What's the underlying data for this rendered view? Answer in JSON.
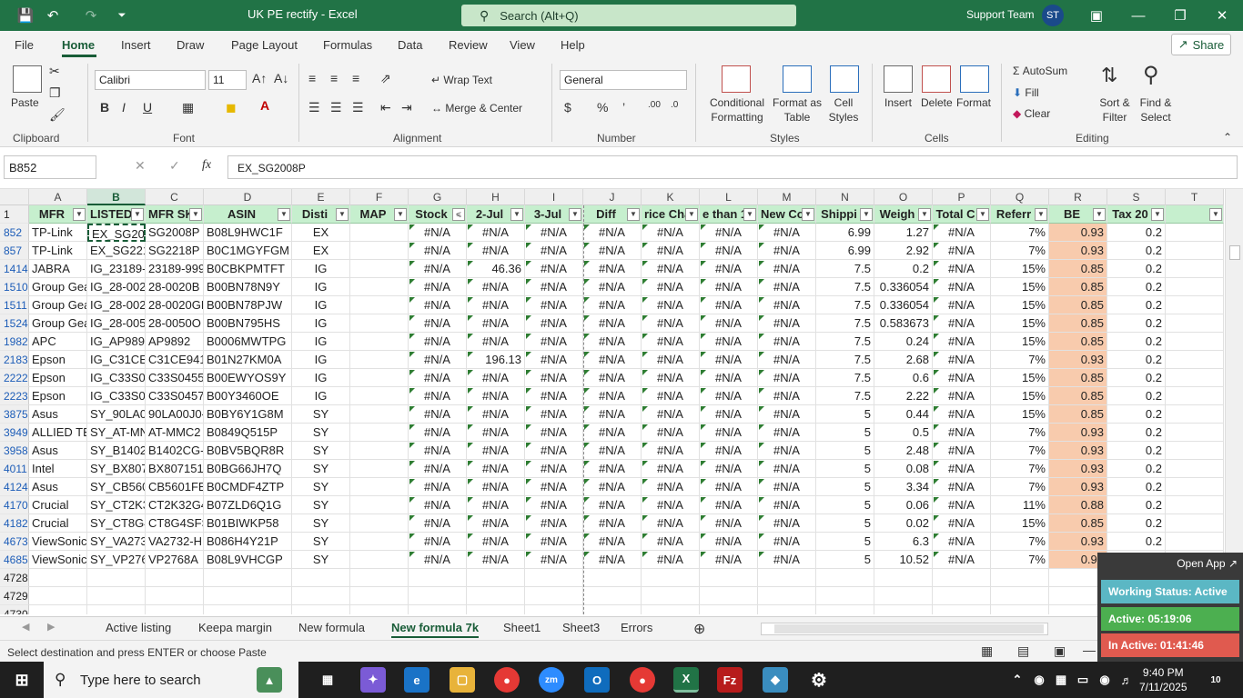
{
  "window": {
    "title": "UK PE rectify  -  Excel",
    "search_placeholder": "Search (Alt+Q)",
    "user_name": "Support Team",
    "user_initials": "ST"
  },
  "menu": [
    "File",
    "Home",
    "Insert",
    "Draw",
    "Page Layout",
    "Formulas",
    "Data",
    "Review",
    "View",
    "Help"
  ],
  "share_label": "Share",
  "ribbon": {
    "paste": "Paste",
    "font_name": "Calibri",
    "font_size": "11",
    "wrap_text": "Wrap Text",
    "merge_center": "Merge & Center",
    "number_format": "General",
    "conditional_formatting": [
      "Conditional",
      "Formatting"
    ],
    "format_as_table": [
      "Format as",
      "Table"
    ],
    "cell_styles": [
      "Cell",
      "Styles"
    ],
    "insert": "Insert",
    "delete": "Delete",
    "format": "Format",
    "autosum": "AutoSum",
    "fill": "Fill",
    "clear": "Clear",
    "sort_filter": [
      "Sort &",
      "Filter"
    ],
    "find_select": [
      "Find &",
      "Select"
    ],
    "groups": [
      "Clipboard",
      "Font",
      "Alignment",
      "Number",
      "Styles",
      "Cells",
      "Editing"
    ]
  },
  "formula_bar": {
    "name_box": "B852",
    "formula": "EX_SG2008P"
  },
  "grid": {
    "columns": [
      "A",
      "B",
      "C",
      "D",
      "E",
      "F",
      "G",
      "H",
      "I",
      "J",
      "K",
      "L",
      "M",
      "N",
      "O",
      "P",
      "Q",
      "R",
      "S",
      "T"
    ],
    "selected_column": "B",
    "header_row_num": "1",
    "headers": [
      "MFR",
      "LISTED S",
      "MFR SK",
      "ASIN",
      "Disti",
      "MAP",
      "Stock",
      "2-Jul",
      "3-Jul",
      "Diff",
      "rice Cha",
      "e than 1",
      "New Co",
      "Shippi",
      "Weigh",
      "Total C",
      "Referr",
      "BE",
      "Tax 20",
      ""
    ],
    "rows": [
      {
        "num": "852",
        "cells": [
          "TP-Link",
          "EX_SG200",
          "SG2008P",
          "B08L9HWC1F",
          "EX",
          "",
          "#N/A",
          "#N/A",
          "#N/A",
          "#N/A",
          "#N/A",
          "#N/A",
          "#N/A",
          "6.99",
          "1.27",
          "#N/A",
          "7%",
          "0.93",
          "0.2"
        ]
      },
      {
        "num": "857",
        "cells": [
          "TP-Link",
          "EX_SG221",
          "SG2218P",
          "B0C1MGYFGM",
          "EX",
          "",
          "#N/A",
          "#N/A",
          "#N/A",
          "#N/A",
          "#N/A",
          "#N/A",
          "#N/A",
          "6.99",
          "2.92",
          "#N/A",
          "7%",
          "0.93",
          "0.2"
        ]
      },
      {
        "num": "1414",
        "cells": [
          "JABRA",
          "IG_23189-",
          "23189-999",
          "B0CBKPMTFT",
          "IG",
          "",
          "#N/A",
          "46.36",
          "#N/A",
          "#N/A",
          "#N/A",
          "#N/A",
          "#N/A",
          "7.5",
          "0.2",
          "#N/A",
          "15%",
          "0.85",
          "0.2"
        ]
      },
      {
        "num": "1510",
        "cells": [
          "Group Gea",
          "IG_28-002",
          "28-0020B",
          "B00BN78N9Y",
          "IG",
          "",
          "#N/A",
          "#N/A",
          "#N/A",
          "#N/A",
          "#N/A",
          "#N/A",
          "#N/A",
          "7.5",
          "0.336054",
          "#N/A",
          "15%",
          "0.85",
          "0.2"
        ]
      },
      {
        "num": "1511",
        "cells": [
          "Group Gea",
          "IG_28-002",
          "28-0020GN",
          "B00BN78PJW",
          "IG",
          "",
          "#N/A",
          "#N/A",
          "#N/A",
          "#N/A",
          "#N/A",
          "#N/A",
          "#N/A",
          "7.5",
          "0.336054",
          "#N/A",
          "15%",
          "0.85",
          "0.2"
        ]
      },
      {
        "num": "1524",
        "cells": [
          "Group Gea",
          "IG_28-005",
          "28-0050O",
          "B00BN795HS",
          "IG",
          "",
          "#N/A",
          "#N/A",
          "#N/A",
          "#N/A",
          "#N/A",
          "#N/A",
          "#N/A",
          "7.5",
          "0.583673",
          "#N/A",
          "15%",
          "0.85",
          "0.2"
        ]
      },
      {
        "num": "1982",
        "cells": [
          "APC",
          "IG_AP989",
          "AP9892",
          "B0006MWTPG",
          "IG",
          "",
          "#N/A",
          "#N/A",
          "#N/A",
          "#N/A",
          "#N/A",
          "#N/A",
          "#N/A",
          "7.5",
          "0.24",
          "#N/A",
          "15%",
          "0.85",
          "0.2"
        ]
      },
      {
        "num": "2183",
        "cells": [
          "Epson",
          "IG_C31CE5",
          "C31CE941",
          "B01N27KM0A",
          "IG",
          "",
          "#N/A",
          "196.13",
          "#N/A",
          "#N/A",
          "#N/A",
          "#N/A",
          "#N/A",
          "7.5",
          "2.68",
          "#N/A",
          "7%",
          "0.93",
          "0.2"
        ]
      },
      {
        "num": "2222",
        "cells": [
          "Epson",
          "IG_C33S04",
          "C33S04554",
          "B00EWYOS9Y",
          "IG",
          "",
          "#N/A",
          "#N/A",
          "#N/A",
          "#N/A",
          "#N/A",
          "#N/A",
          "#N/A",
          "7.5",
          "0.6",
          "#N/A",
          "15%",
          "0.85",
          "0.2"
        ]
      },
      {
        "num": "2223",
        "cells": [
          "Epson",
          "IG_C33S04",
          "C33S04571",
          "B00Y3460OE",
          "IG",
          "",
          "#N/A",
          "#N/A",
          "#N/A",
          "#N/A",
          "#N/A",
          "#N/A",
          "#N/A",
          "7.5",
          "2.22",
          "#N/A",
          "15%",
          "0.85",
          "0.2"
        ]
      },
      {
        "num": "3875",
        "cells": [
          "Asus",
          "SY_90LA00",
          "90LA00J0-",
          "B0BY6Y1G8M",
          "SY",
          "",
          "#N/A",
          "#N/A",
          "#N/A",
          "#N/A",
          "#N/A",
          "#N/A",
          "#N/A",
          "5",
          "0.44",
          "#N/A",
          "15%",
          "0.85",
          "0.2"
        ]
      },
      {
        "num": "3949",
        "cells": [
          "ALLIED TEL",
          "SY_AT-MN",
          "AT-MMC2",
          "B0849Q515P",
          "SY",
          "",
          "#N/A",
          "#N/A",
          "#N/A",
          "#N/A",
          "#N/A",
          "#N/A",
          "#N/A",
          "5",
          "0.5",
          "#N/A",
          "7%",
          "0.93",
          "0.2"
        ]
      },
      {
        "num": "3958",
        "cells": [
          "Asus",
          "SY_B1402",
          "B1402CG-I",
          "B0BV5BQR8R",
          "SY",
          "",
          "#N/A",
          "#N/A",
          "#N/A",
          "#N/A",
          "#N/A",
          "#N/A",
          "#N/A",
          "5",
          "2.48",
          "#N/A",
          "7%",
          "0.93",
          "0.2"
        ]
      },
      {
        "num": "4011",
        "cells": [
          "Intel",
          "SY_BX807",
          "BX807151",
          "B0BG66JH7Q",
          "SY",
          "",
          "#N/A",
          "#N/A",
          "#N/A",
          "#N/A",
          "#N/A",
          "#N/A",
          "#N/A",
          "5",
          "0.08",
          "#N/A",
          "7%",
          "0.93",
          "0.2"
        ]
      },
      {
        "num": "4124",
        "cells": [
          "Asus",
          "SY_CB560",
          "CB5601FB",
          "B0CMDF4ZTP",
          "SY",
          "",
          "#N/A",
          "#N/A",
          "#N/A",
          "#N/A",
          "#N/A",
          "#N/A",
          "#N/A",
          "5",
          "3.34",
          "#N/A",
          "7%",
          "0.93",
          "0.2"
        ]
      },
      {
        "num": "4170",
        "cells": [
          "Crucial",
          "SY_CT2K3",
          "CT2K32G4",
          "B07ZLD6Q1G",
          "SY",
          "",
          "#N/A",
          "#N/A",
          "#N/A",
          "#N/A",
          "#N/A",
          "#N/A",
          "#N/A",
          "5",
          "0.06",
          "#N/A",
          "11%",
          "0.88",
          "0.2"
        ]
      },
      {
        "num": "4182",
        "cells": [
          "Crucial",
          "SY_CT8G4",
          "CT8G4SFS",
          "B01BIWKP58",
          "SY",
          "",
          "#N/A",
          "#N/A",
          "#N/A",
          "#N/A",
          "#N/A",
          "#N/A",
          "#N/A",
          "5",
          "0.02",
          "#N/A",
          "15%",
          "0.85",
          "0.2"
        ]
      },
      {
        "num": "4673",
        "cells": [
          "ViewSonic",
          "SY_VA273",
          "VA2732-H",
          "B086H4Y21P",
          "SY",
          "",
          "#N/A",
          "#N/A",
          "#N/A",
          "#N/A",
          "#N/A",
          "#N/A",
          "#N/A",
          "5",
          "6.3",
          "#N/A",
          "7%",
          "0.93",
          "0.2"
        ]
      },
      {
        "num": "4685",
        "cells": [
          "ViewSonic",
          "SY_VP276",
          "VP2768A",
          "B08L9VHCGP",
          "SY",
          "",
          "#N/A",
          "#N/A",
          "#N/A",
          "#N/A",
          "#N/A",
          "#N/A",
          "#N/A",
          "5",
          "10.52",
          "#N/A",
          "7%",
          "0.93",
          "0.2"
        ]
      }
    ],
    "empty_rows": [
      "4728",
      "4729",
      "4730"
    ]
  },
  "sheets": {
    "tabs": [
      "Active listing",
      "Keepa margin",
      "New formula",
      "New formula 7k",
      "Sheet1",
      "Sheet3",
      "Errors"
    ],
    "active": "New formula 7k"
  },
  "status": {
    "message": "Select destination and press ENTER or choose Paste",
    "zoom": "100%"
  },
  "overlay": {
    "open_app": "Open App",
    "working_status": "Working Status: Active",
    "active_time": "Active: 05:19:06",
    "inactive_time": "In Active: 01:41:46",
    "colors": {
      "working": "#5bb7c4",
      "active": "#4caf50",
      "inactive": "#e05a4f"
    }
  },
  "taskbar": {
    "search_placeholder": "Type here to search",
    "time": "9:40 PM",
    "date": "7/11/2025",
    "notifications": "10"
  },
  "colors": {
    "excel_green": "#217346",
    "header_fill": "#c6efce",
    "be_fill": "#f8cbad"
  }
}
